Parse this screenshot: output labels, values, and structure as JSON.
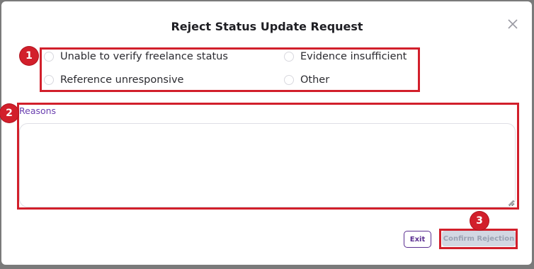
{
  "dialog": {
    "title": "Reject Status Update Request",
    "close_icon": "close-icon"
  },
  "options": [
    {
      "label": "Unable to verify freelance status",
      "selected": false
    },
    {
      "label": "Evidence insufficient",
      "selected": false
    },
    {
      "label": "Reference unresponsive",
      "selected": false
    },
    {
      "label": "Other",
      "selected": false
    }
  ],
  "reasons": {
    "label": "Reasons",
    "value": ""
  },
  "buttons": {
    "exit": "Exit",
    "confirm": "Confirm Rejection",
    "confirm_enabled": false
  },
  "annotations": [
    "1",
    "2",
    "3"
  ],
  "colors": {
    "annotation": "#d21f2b",
    "accent": "#5b2f91",
    "disabled_button": "#d2d7e2"
  }
}
